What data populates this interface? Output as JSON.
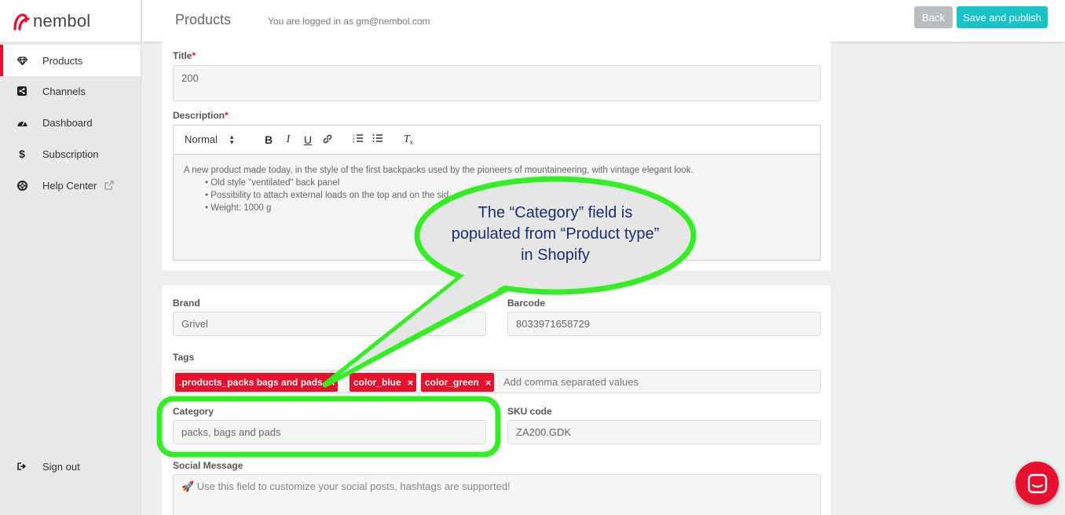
{
  "brand": {
    "logo_text": "nembol",
    "accent": "#e8112d",
    "teal": "#17c3c6"
  },
  "sidebar": {
    "items": [
      {
        "label": "Products",
        "icon": "diamond-icon",
        "active": true
      },
      {
        "label": "Channels",
        "icon": "share-icon"
      },
      {
        "label": "Dashboard",
        "icon": "gauge-icon"
      },
      {
        "label": "Subscription",
        "icon": "dollar-icon"
      },
      {
        "label": "Help Center",
        "icon": "lifebuoy-icon"
      }
    ],
    "sign_out": "Sign out"
  },
  "header": {
    "title": "Products",
    "login_info": "You are logged in as gm@nembol.com",
    "back_label": "Back",
    "save_label": "Save and publish"
  },
  "form": {
    "title_label": "Title",
    "title_value": "200",
    "description_label": "Description",
    "toolbar": {
      "format": "Normal"
    },
    "description": {
      "intro": "A new product made today, in the style of the first backpacks used by the pioneers of mountaineering, with vintage elegant look.",
      "bullets": [
        "Old style \"ventilated\" back panel",
        "Possibility to attach external loads on the top and on the sid",
        "Weight: 1000 g"
      ]
    },
    "brand_label": "Brand",
    "brand_value": "Grivel",
    "barcode_label": "Barcode",
    "barcode_value": "8033971658729",
    "tags_label": "Tags",
    "tags": [
      ".products_packs bags and pads",
      "color_blue",
      "color_green"
    ],
    "tags_placeholder": "Add comma separated values",
    "category_label": "Category",
    "category_value": "packs, bags and pads",
    "sku_label": "SKU code",
    "sku_value": "ZA200.GDK",
    "social_label": "Social Message",
    "social_placeholder": "🚀 Use this field to customize your social posts, hashtags are supported!"
  },
  "callout": {
    "lines": [
      "The “Category” field is",
      "populated from “Product type”",
      "in Shopify"
    ],
    "color": "#33ee22"
  }
}
